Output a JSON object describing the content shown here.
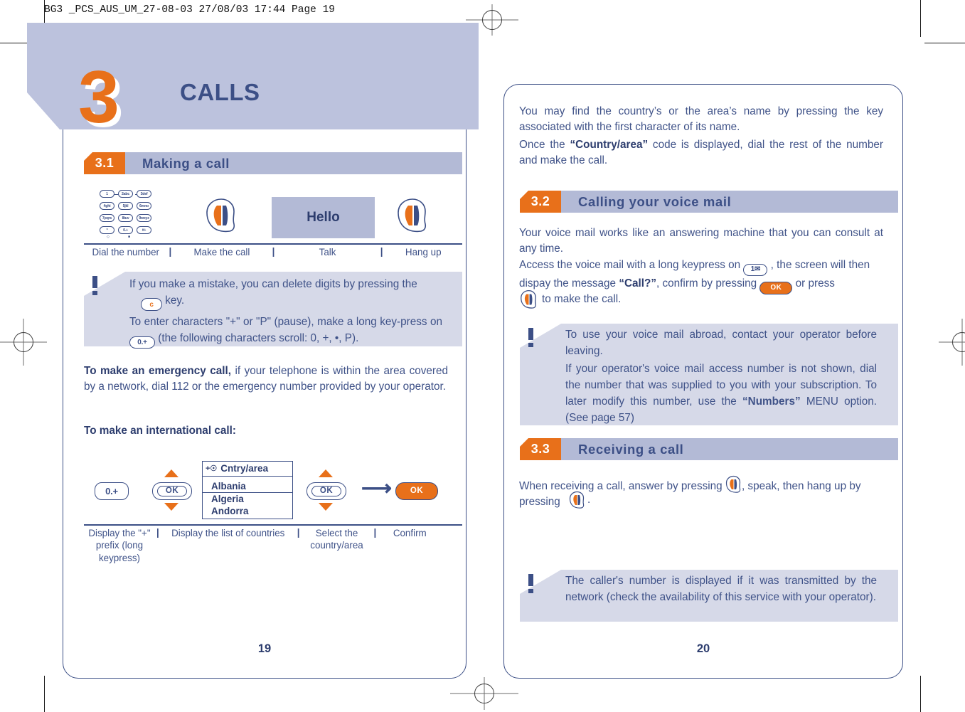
{
  "print_header": "BG3 _PCS_AUS_UM_27-08-03  27/08/03  17:44  Page 19",
  "colors": {
    "orange": "#e8701a",
    "navy": "#3c4f86",
    "band": "#bcc2dd",
    "section_bar": "#b3bad6",
    "note_bg": "#d6d9e8"
  },
  "chapter": {
    "number": "3",
    "title": "CALLS"
  },
  "left_page": {
    "page_number": "19",
    "section_3_1": {
      "number": "3.1",
      "title": "Making a call"
    },
    "making_call_steps": [
      {
        "label": "Dial the number",
        "icon": "keypad-icon"
      },
      {
        "label": "Make the call",
        "icon": "call-key-icon"
      },
      {
        "label": "Talk",
        "icon": "screen-hello",
        "screen_text": "Hello"
      },
      {
        "label": "Hang up",
        "icon": "call-key-icon"
      }
    ],
    "keypad_keys": [
      [
        "1",
        "2 abc",
        "3 def"
      ],
      [
        "4 ghi",
        "5 jkl",
        "6 mno"
      ],
      [
        "7 pqrs",
        "8 tuv",
        "9 wxyz"
      ],
      [
        "*",
        "0 . +",
        "# +"
      ]
    ],
    "note_1": {
      "bang": "!",
      "line1_a": "If you make a mistake, you can delete digits by pressing the",
      "key_c": "c",
      "line1_b": " key.",
      "line2_a": "To enter characters \"+\" or \"P\" (pause), make a long key-press on",
      "key_0": "0.+",
      "line2_b": " (the following characters scroll: 0, +, •, P)."
    },
    "emergency": {
      "bold": "To make an emergency call,",
      "rest": " if your telephone is within the area covered by a network, dial 112 or the emergency number provided by your operator."
    },
    "international_heading": "To make an international call:",
    "intl_menu": {
      "title": "Cntry/area",
      "title_prefix": "+",
      "rows": [
        "Albania",
        "Algeria",
        "Andorra"
      ],
      "selected": "Albania"
    },
    "intl_buttons": {
      "key_0": "0.+",
      "ok": "OK",
      "ok2": "OK",
      "ok_confirm": "OK"
    },
    "intl_steps": [
      "Display the \"+\" prefix (long keypress)",
      "Display the list of countries",
      "Select the country/area",
      "Confirm"
    ]
  },
  "right_page": {
    "page_number": "20",
    "intro": {
      "p1": "You may find the country’s or the area’s name by pressing the key associated with the first character of its name.",
      "p2_a": "Once the ",
      "p2_bold": "“Country/area”",
      "p2_b": " code is displayed, dial the rest of the number and make the call."
    },
    "section_3_2": {
      "number": "3.2",
      "title": "Calling your voice mail"
    },
    "voicemail": {
      "l1": "Your voice mail works like an answering machine that you can consult at any time.",
      "l2_a": "Access the voice mail with a long keypress on ",
      "key_1": "1",
      "l2_b": " , the screen will then dispay the message ",
      "l2_bold": "“Call?”",
      "l2_c": ", confirm by pressing ",
      "ok": "OK",
      "l2_d": " or press ",
      "l2_e": " to make the call."
    },
    "note_2": {
      "bang": "!",
      "l1": "To use your voice mail abroad, contact your operator before leaving.",
      "l2": "If your operator's voice mail access number is not shown, dial the number that was supplied to you with your subscription. To later modify this number, use the ",
      "l2_bold": "“Numbers”",
      "l3": " MENU option. (See page 57)"
    },
    "section_3_3": {
      "number": "3.3",
      "title": "Receiving a call"
    },
    "receiving": {
      "a": "When receiving a call, answer by pressing ",
      "b": ", speak, then hang up by pressing ",
      "c": "."
    },
    "note_3": {
      "bang": "!",
      "text": "The caller's number is displayed if it was transmitted by the network (check the availability of this service with your operator)."
    }
  }
}
